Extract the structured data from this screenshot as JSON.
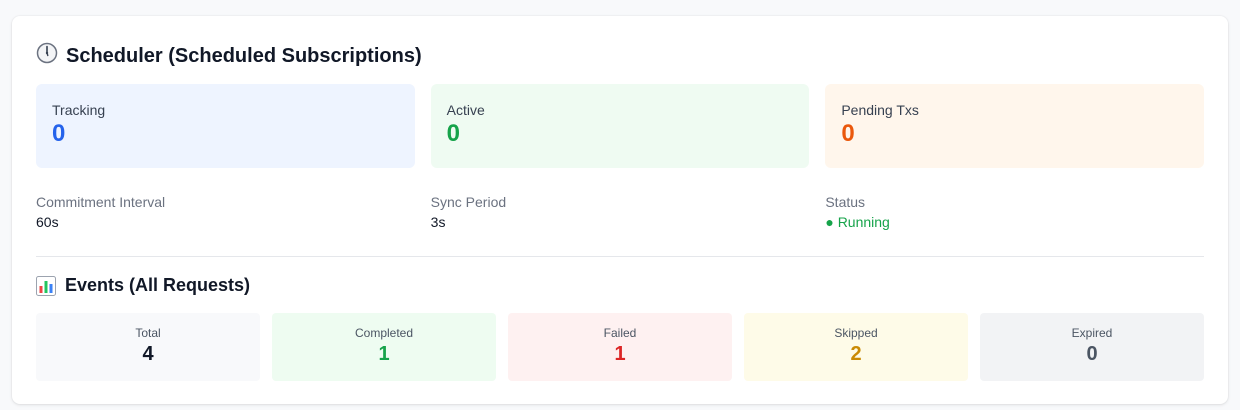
{
  "scheduler": {
    "title": "Scheduler (Scheduled Subscriptions)",
    "icon": "clock-icon",
    "stats": [
      {
        "label": "Tracking",
        "value": "0",
        "value_color": "#2563eb",
        "bg_color": "#eef4ff"
      },
      {
        "label": "Active",
        "value": "0",
        "value_color": "#16a34a",
        "bg_color": "#effbf2"
      },
      {
        "label": "Pending Txs",
        "value": "0",
        "value_color": "#ea580c",
        "bg_color": "#fff6ec"
      }
    ],
    "info": [
      {
        "label": "Commitment Interval",
        "value": "60s",
        "value_color": "#111827"
      },
      {
        "label": "Sync Period",
        "value": "3s",
        "value_color": "#111827"
      },
      {
        "label": "Status",
        "value": "● Running",
        "value_color": "#16a34a"
      }
    ]
  },
  "events": {
    "title": "Events (All Requests)",
    "icon": "bar-chart-icon",
    "items": [
      {
        "label": "Total",
        "value": "4",
        "value_color": "#111827",
        "bg_color": "#f8f9fb"
      },
      {
        "label": "Completed",
        "value": "1",
        "value_color": "#16a34a",
        "bg_color": "#eefcf1"
      },
      {
        "label": "Failed",
        "value": "1",
        "value_color": "#dc2626",
        "bg_color": "#fef1f1"
      },
      {
        "label": "Skipped",
        "value": "2",
        "value_color": "#ca8a04",
        "bg_color": "#fefbe8"
      },
      {
        "label": "Expired",
        "value": "0",
        "value_color": "#4b5563",
        "bg_color": "#f2f3f5"
      }
    ]
  }
}
